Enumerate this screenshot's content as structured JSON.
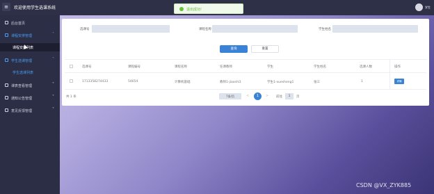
{
  "header": {
    "app_title": "欢迎使用学生选课系统",
    "toast_text": "退出成功!",
    "user_name": "学生"
  },
  "sidebar": {
    "home": "后台首页",
    "course_group": "课程安排管理",
    "course_sub": "课程安排列表",
    "select_group": "学生选课管理",
    "select_sub": "学生选课列表",
    "group3": "课表查看管理",
    "group4": "通知公告管理",
    "group5": "意见反馈管理"
  },
  "filters": {
    "label1": "选课号",
    "label2": "课程名称",
    "label3": "学生姓名",
    "query_label": "查询",
    "reset_label": "重置"
  },
  "table": {
    "headers": [
      "选课号",
      "课程编号",
      "课程名称",
      "任课教师",
      "学生",
      "学生姓名",
      "选课人数",
      "操作"
    ],
    "rows": [
      [
        "1713358274433",
        "54654",
        "计算机基础",
        "教师1-jiaoshi1",
        "学生1-xuesheng1",
        "张三",
        "1",
        "详情"
      ]
    ]
  },
  "pagination": {
    "total": "共 1 条",
    "page_size": "7条/页",
    "prev": "<",
    "next": ">",
    "current": "1",
    "goto_label": "前往",
    "goto_value": "1",
    "goto_suffix": "页"
  },
  "watermark": "CSDN @VX_ZYK885",
  "colors": {
    "primary": "#3a82d6",
    "sidebar_bg": "#2b2e44",
    "topbar_bg": "#2d3046",
    "success": "#67c23a"
  }
}
